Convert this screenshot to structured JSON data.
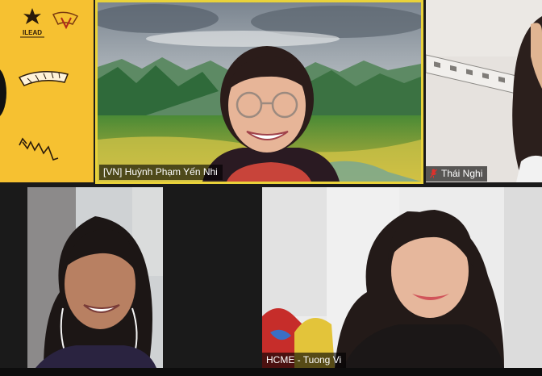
{
  "meeting": {
    "participants": [
      {
        "name": "",
        "role": "shared-banner",
        "logos": [
          "ILEAD",
          "ASEAN Youth"
        ]
      },
      {
        "name": "[VN] Huỳnh Phạm Yến Nhi",
        "active_speaker": true
      },
      {
        "name": "Thái Nghi",
        "muted": true
      },
      {
        "name": ""
      },
      {
        "name": "HCME - Tuong Vi"
      }
    ]
  },
  "colors": {
    "active_speaker_border": "#e9d23a",
    "banner_yellow": "#f6c131",
    "mute_red": "#e0302b"
  }
}
